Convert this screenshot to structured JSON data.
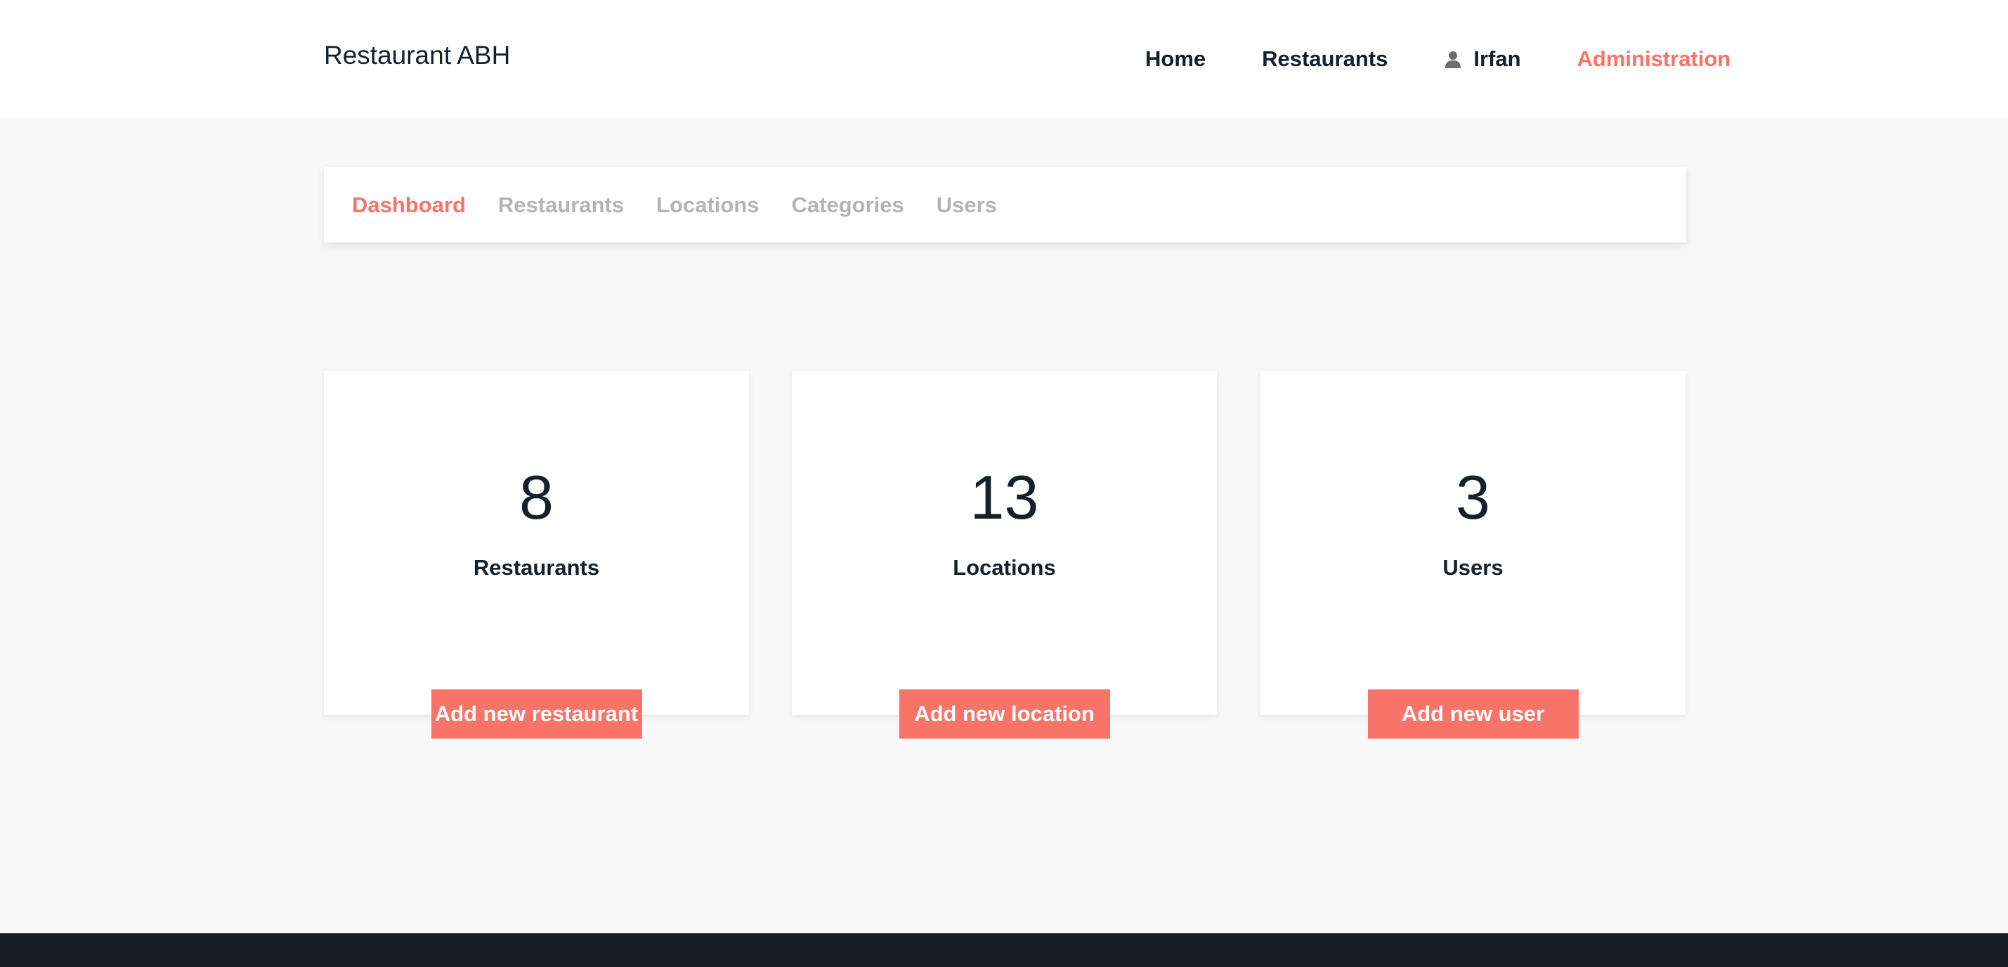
{
  "colors": {
    "accent": "#f87368",
    "text": "#14202a",
    "muted": "#b4b4b4",
    "footer": "#141e24"
  },
  "header": {
    "brand": "Restaurant ABH",
    "nav": {
      "home": "Home",
      "restaurants": "Restaurants",
      "user": "Irfan",
      "user_icon": "user-icon",
      "administration": "Administration"
    }
  },
  "subnav": {
    "tabs": [
      {
        "label": "Dashboard",
        "active": true
      },
      {
        "label": "Restaurants",
        "active": false
      },
      {
        "label": "Locations",
        "active": false
      },
      {
        "label": "Categories",
        "active": false
      },
      {
        "label": "Users",
        "active": false
      }
    ]
  },
  "cards": [
    {
      "count": "8",
      "label": "Restaurants",
      "button": "Add new restaurant"
    },
    {
      "count": "13",
      "label": "Locations",
      "button": "Add new location"
    },
    {
      "count": "3",
      "label": "Users",
      "button": "Add new user"
    }
  ]
}
